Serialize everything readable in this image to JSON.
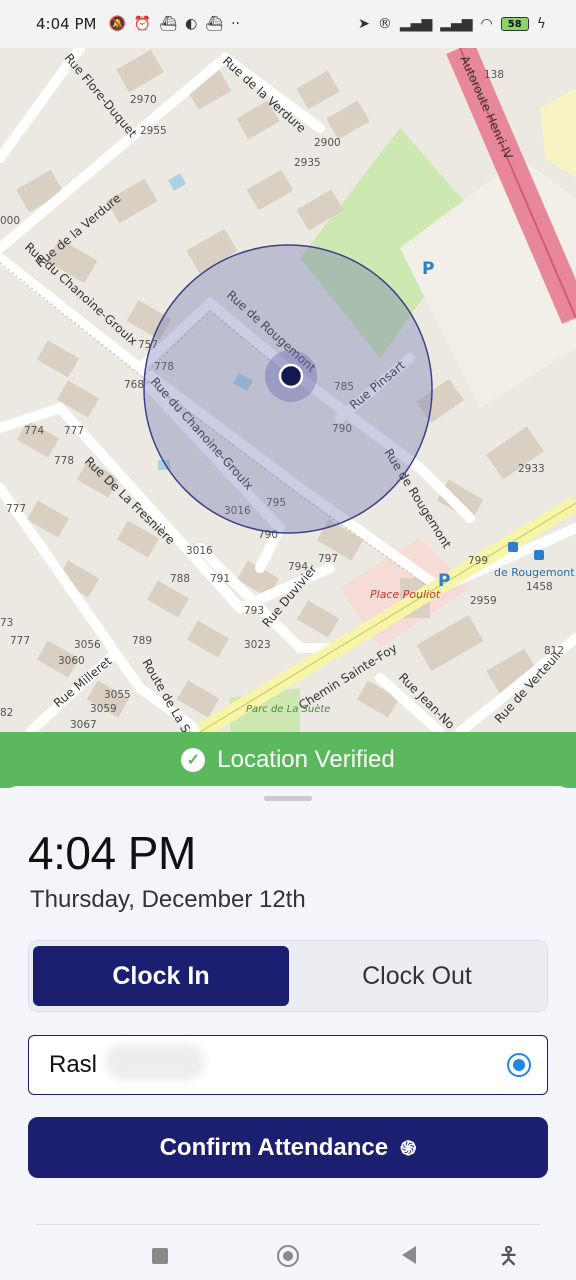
{
  "status_bar": {
    "time": "4:04 PM",
    "left_icons": [
      "mute-icon",
      "alarm-icon",
      "ship-icon",
      "data-saver-icon",
      "ship-icon",
      "more-dots-icon"
    ],
    "right_icons": [
      "location-arrow-icon",
      "registered-icon",
      "signal-icon",
      "signal-icon",
      "wifi-icon",
      "battery-icon",
      "charging-icon"
    ],
    "battery_level": "58"
  },
  "map": {
    "roads": [
      "Rue Flore-Duquet",
      "Rue de la Verdure",
      "Rue de la Verdure",
      "Autoroute Henri-IV",
      "Rue du Chanoine-Groulx",
      "Rue de Rougemont",
      "Rue Pinsart",
      "Rue du Chanoine-Groulx",
      "Rue de Rougemont",
      "Rue De La Fresnière",
      "Rue Duvivier",
      "Chemin Sainte-Foy",
      "Rue Jean-No",
      "Rue de Verteuil",
      "Rue Milleret",
      "Route de La Suè"
    ],
    "places": [
      "Place Pouliot",
      "de Rougemont",
      "Parc de La Suète"
    ],
    "house_numbers": [
      "2970",
      "2955",
      "2935",
      "2900",
      "138",
      "000",
      "778",
      "768",
      "757",
      "785",
      "790",
      "774",
      "777",
      "778",
      "777",
      "3016",
      "3016",
      "795",
      "790",
      "797",
      "794",
      "788",
      "791",
      "793",
      "3023",
      "2933",
      "799",
      "1458",
      "2959",
      "812",
      "73",
      "777",
      "789",
      "3056",
      "3060",
      "3055",
      "3059",
      "3067",
      "82"
    ],
    "parking_symbol": "P"
  },
  "banner": {
    "text": "Location Verified",
    "color": "#5cb85c"
  },
  "sheet": {
    "time": "4:04 PM",
    "date": "Thursday, December 12th",
    "segment": {
      "clock_in": "Clock In",
      "clock_out": "Clock Out",
      "selected": "Clock In"
    },
    "site_field": {
      "value": "Rasl"
    },
    "confirm_button": "Confirm Attendance",
    "accent_color": "#1c1f6f"
  },
  "nav_bar": {
    "icons": [
      "recent-apps-icon",
      "home-icon",
      "back-icon",
      "accessibility-icon"
    ]
  }
}
